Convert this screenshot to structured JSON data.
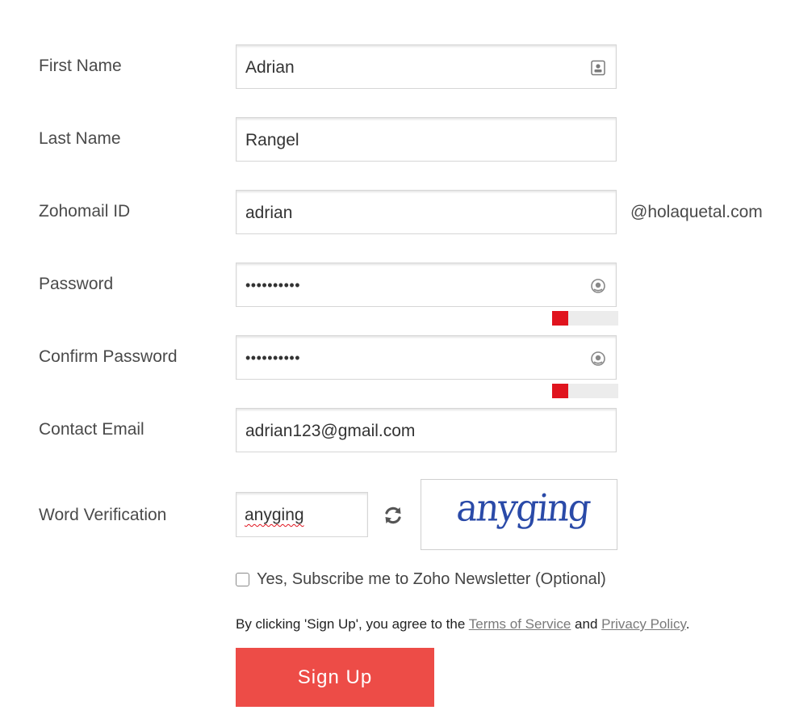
{
  "form": {
    "first_name": {
      "label": "First Name",
      "value": "Adrian"
    },
    "last_name": {
      "label": "Last Name",
      "value": "Rangel"
    },
    "zohomail_id": {
      "label": "Zohomail ID",
      "value": "adrian",
      "domain_suffix": "@holaquetal.com"
    },
    "password": {
      "label": "Password",
      "value": "••••••••••",
      "strength": 0.24
    },
    "confirm_password": {
      "label": "Confirm Password",
      "value": "••••••••••",
      "strength": 0.24
    },
    "contact_email": {
      "label": "Contact Email",
      "value": "adrian123@gmail.com"
    },
    "word_verification": {
      "label": "Word Verification",
      "value": "anyging",
      "captcha_text": "anyging"
    },
    "newsletter": {
      "label": "Yes, Subscribe me to Zoho Newsletter (Optional)",
      "checked": false
    },
    "terms": {
      "prefix": "By clicking 'Sign Up', you agree to the ",
      "terms_link": "Terms of Service",
      "and": " and ",
      "privacy_link": "Privacy Policy",
      "suffix": "."
    },
    "signup_button": "Sign Up"
  },
  "colors": {
    "strength_weak": "#e0141e",
    "signup_button": "#ed4c47",
    "captcha_text": "#2a4aa8"
  },
  "icons": {
    "first_name": "contact-card-icon",
    "password": "eye-reveal-icon",
    "refresh": "refresh-icon"
  }
}
